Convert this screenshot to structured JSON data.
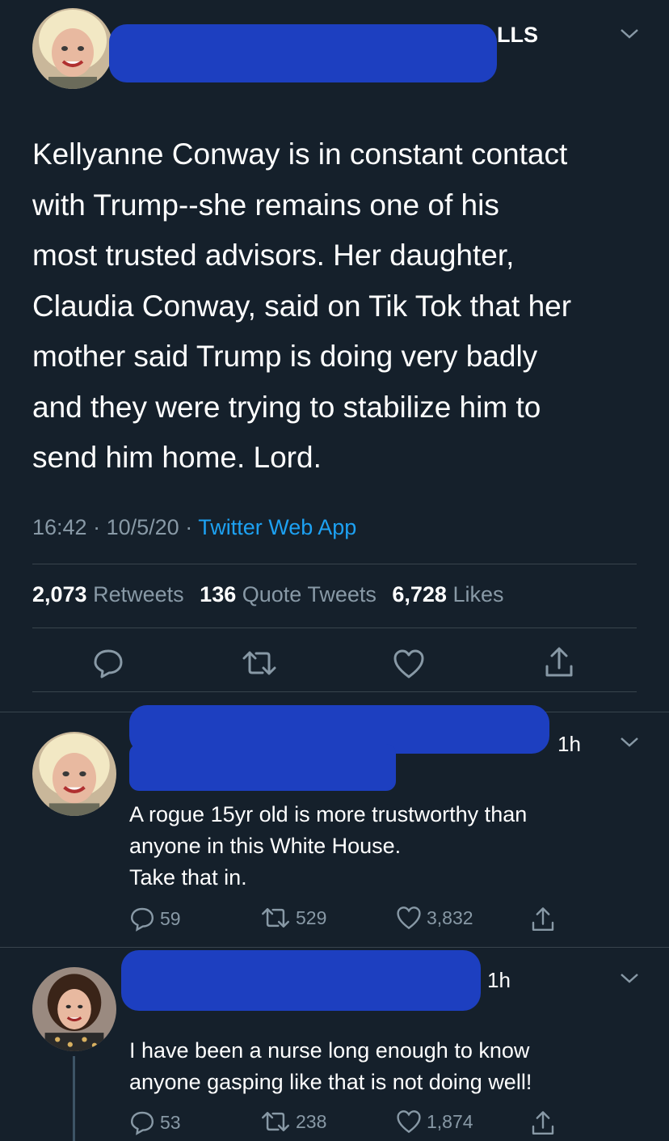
{
  "tweet": {
    "name_tail": "LLS",
    "text": "Kellyanne Conway is in constant contact\nwith Trump--she remains one of his\nmost trusted advisors. Her daughter,\nClaudia Conway, said on Tik Tok that her\nmother said Trump is doing very badly\nand they were trying to stabilize him to\nsend him home. Lord.",
    "time": "16:42",
    "date": "10/5/20",
    "sep": "·",
    "source": "Twitter Web App",
    "retweets_count": "2,073",
    "retweets_label": "Retweets",
    "quotes_count": "136",
    "quotes_label": "Quote Tweets",
    "likes_count": "6,728",
    "likes_label": "Likes"
  },
  "replies": [
    {
      "time": "1h",
      "text": "A rogue 15yr old is more trustworthy than\nanyone in this White House.\nTake that in.",
      "replies": "59",
      "retweets": "529",
      "likes": "3,832"
    },
    {
      "time": "1h",
      "text": "I have been a nurse long enough to know\nanyone gasping like that is not doing well!",
      "replies": "53",
      "retweets": "238",
      "likes": "1,874"
    }
  ],
  "colors": {
    "background": "#15202b",
    "secondary_text": "#8899a6",
    "link": "#1da1f2",
    "divider": "#38444d",
    "redaction": "#1d3fc0"
  },
  "icons": [
    "reply-icon",
    "retweet-icon",
    "like-icon",
    "share-icon",
    "chevron-down-icon"
  ]
}
